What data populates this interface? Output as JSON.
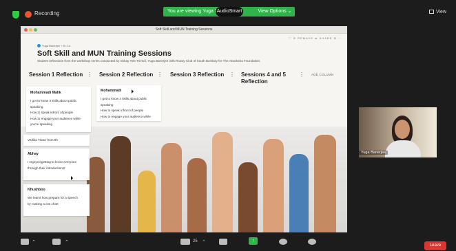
{
  "topbar": {
    "recording_label": "Recording",
    "viewing_text": "You are viewing Yuga S",
    "viewing_speaker": "AudioSmart",
    "view_options_label": "View Options ⌄",
    "view_label": "View"
  },
  "window": {
    "title": "Soft Skill and MUN Training Sessions"
  },
  "board": {
    "tools_text": "♡  ⟳ REMAKE  ➦ SHARE  ✲  ⋯",
    "author": "Yuga Banerjee + 8 • 1d",
    "title": "Soft Skill and MUN Training Sessions",
    "subtitle": "Student reflections from the workshop series conducted by Abhay Tole Trivedi, Yuga Banerjee with Rotary Club of South Bombay for The Akanksha Foundation.",
    "add_column": "ADD COLUMN",
    "columns": [
      {
        "title": "Session 1 Reflection"
      },
      {
        "title": "Session 2 Reflection"
      },
      {
        "title": "Session 3 Reflection"
      },
      {
        "title": "Sessions 4 and 5\nReflection"
      }
    ]
  },
  "cards": [
    {
      "name": "Mohammadi Malik",
      "lines": [
        "I got to know 4 skills about public",
        "speaking",
        "How to speak infront of people",
        "How to engage your audience while",
        "you're speaking"
      ]
    },
    {
      "name": "Mohammadi",
      "lines": [
        "I got to know 4 skills about public",
        "speaking",
        "How to speak infront of people",
        "How to engage your audience while"
      ]
    },
    {
      "name": "",
      "lines": [
        "Vedika Tiwari from 9h"
      ]
    },
    {
      "name": "Abhay",
      "lines": [
        "I enjoyed getting to know everyone",
        "through their introductions!"
      ]
    },
    {
      "name": "Khushboo",
      "lines": [
        "We learnt how prepare for a speech",
        "by making a ces chart"
      ]
    }
  ],
  "video": {
    "participant": "Yuga Banerjee"
  },
  "toolbar": {
    "participants_count": "25",
    "leave_label": "Leave"
  },
  "colors": {
    "zoom_green": "#2fb34a",
    "leave_red": "#d9372f",
    "padlet_blue": "#2b8fe6"
  }
}
